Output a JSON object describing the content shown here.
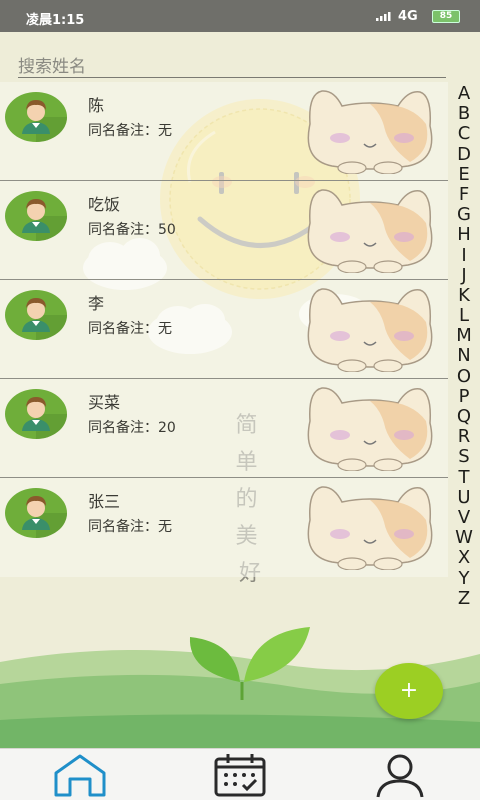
{
  "status_bar": {
    "time": "凌晨1:15",
    "network": "4G",
    "battery": "85"
  },
  "search": {
    "placeholder": "搜索姓名"
  },
  "contacts": [
    {
      "name": "陈",
      "note_label": "同名备注：",
      "note": "无"
    },
    {
      "name": "吃饭",
      "note_label": "同名备注：",
      "note": "50"
    },
    {
      "name": "李",
      "note_label": "同名备注：",
      "note": "无"
    },
    {
      "name": "买菜",
      "note_label": "同名备注：",
      "note": "20"
    },
    {
      "name": "张三",
      "note_label": "同名备注：",
      "note": "无"
    }
  ],
  "index_letters": [
    "A",
    "B",
    "C",
    "D",
    "E",
    "F",
    "G",
    "H",
    "I",
    "J",
    "K",
    "L",
    "M",
    "N",
    "O",
    "P",
    "Q",
    "R",
    "S",
    "T",
    "U",
    "V",
    "W",
    "X",
    "Y",
    "Z"
  ],
  "background_text": "简单的美好",
  "fab": {
    "label": "+"
  },
  "bottom_nav": [
    {
      "icon": "home-icon",
      "active": true
    },
    {
      "icon": "calendar-icon",
      "active": false
    },
    {
      "icon": "person-icon",
      "active": false
    }
  ],
  "colors": {
    "accent": "#9ccf23",
    "active_nav": "#1f8fc9",
    "inactive_nav": "#2a2a2a",
    "avatar_bg": "#6fae3a"
  }
}
